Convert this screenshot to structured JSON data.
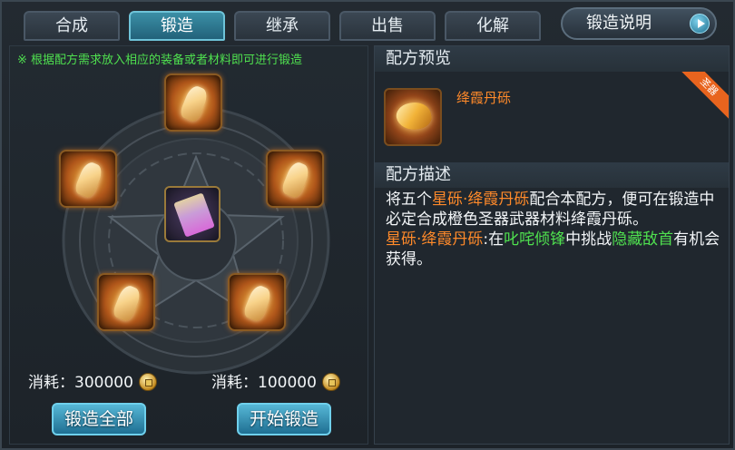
{
  "tabs": [
    {
      "label": "合成",
      "active": false
    },
    {
      "label": "锻造",
      "active": true
    },
    {
      "label": "继承",
      "active": false
    },
    {
      "label": "出售",
      "active": false
    },
    {
      "label": "化解",
      "active": false
    }
  ],
  "info_button": {
    "label": "锻造说明",
    "icon": "play-arrow-icon"
  },
  "left": {
    "hint": "※ 根据配方需求放入相应的装备或者材料即可进行锻造",
    "slots": [
      "crystal-icon",
      "crystal-icon",
      "crystal-icon",
      "crystal-icon",
      "crystal-icon"
    ],
    "center_slot": "scroll-icon",
    "cost_all": {
      "label": "消耗：",
      "amount": "300000",
      "icon": "copper-coin-icon"
    },
    "cost_single": {
      "label": "消耗：",
      "amount": "100000",
      "icon": "copper-coin-icon"
    },
    "forge_all_label": "锻造全部",
    "start_forge_label": "开始锻造"
  },
  "right": {
    "preview_title": "配方预览",
    "item_name": "绛霞丹砾",
    "badge": "圣器",
    "desc_title": "配方描述",
    "desc": {
      "p1_a": "将五个",
      "p1_b": "星砾·绛霞丹砾",
      "p1_c": "配合本配方，便可在锻造中必定合成橙色圣器武器材料绛霞丹砾。",
      "p2_a": "星砾·绛霞丹砾",
      "p2_b": ":在",
      "p2_c": "叱咤倾锋",
      "p2_d": "中挑战",
      "p2_e": "隐藏敌首",
      "p2_f": "有机会获得。"
    }
  },
  "colors": {
    "accent": "#3b8fa6",
    "orange": "#ff8a2a",
    "green": "#4fe04f"
  }
}
